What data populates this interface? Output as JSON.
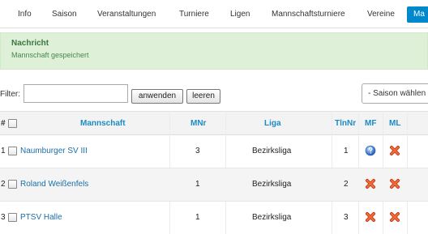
{
  "tabs": [
    {
      "label": "Info",
      "active": false
    },
    {
      "label": "Saison",
      "active": false
    },
    {
      "label": "Veranstaltungen",
      "active": false
    },
    {
      "label": "Turniere",
      "active": false
    },
    {
      "label": "Ligen",
      "active": false
    },
    {
      "label": "Mannschaftsturniere",
      "active": false
    },
    {
      "label": "Vereine",
      "active": false
    },
    {
      "label": "Ma",
      "active": true
    }
  ],
  "message": {
    "title": "Nachricht",
    "text": "Mannschaft gespeichert"
  },
  "filter": {
    "label": "Filter:",
    "value": "",
    "apply_label": "anwenden",
    "clear_label": "leeren",
    "season_select": "- Saison wählen -"
  },
  "table": {
    "headers": {
      "hash": "#",
      "team": "Mannschaft",
      "mnr": "MNr",
      "league": "Liga",
      "tlnnr": "TlnNr",
      "mf": "MF",
      "ml": "ML"
    },
    "rows": [
      {
        "index": "1",
        "team": "Naumburger SV III",
        "mnr": "3",
        "league": "Bezirksliga",
        "tlnnr": "1",
        "mf_icon": "info-globe-icon",
        "ml_icon": "delete-x-icon"
      },
      {
        "index": "2",
        "team": "Roland Weißenfels",
        "mnr": "1",
        "league": "Bezirksliga",
        "tlnnr": "2",
        "mf_icon": "delete-x-icon",
        "ml_icon": "delete-x-icon"
      },
      {
        "index": "3",
        "team": "PTSV Halle",
        "mnr": "1",
        "league": "Bezirksliga",
        "tlnnr": "3",
        "mf_icon": "delete-x-icon",
        "ml_icon": "delete-x-icon"
      }
    ]
  },
  "colors": {
    "accent": "#0088cc",
    "link": "#1b6fa8",
    "success_bg": "#dff0d8",
    "success_text": "#3c763d"
  }
}
